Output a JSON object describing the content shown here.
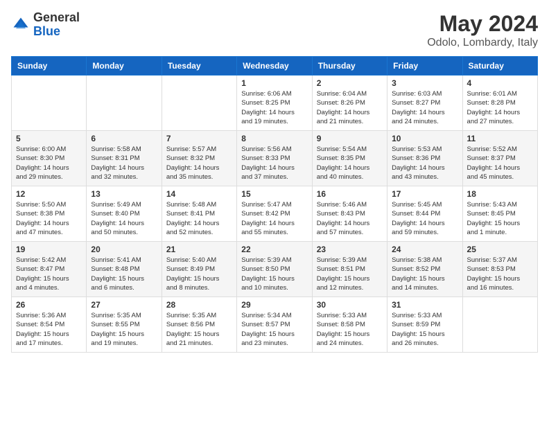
{
  "header": {
    "logo_general": "General",
    "logo_blue": "Blue",
    "month_title": "May 2024",
    "location": "Odolo, Lombardy, Italy"
  },
  "weekdays": [
    "Sunday",
    "Monday",
    "Tuesday",
    "Wednesday",
    "Thursday",
    "Friday",
    "Saturday"
  ],
  "weeks": [
    [
      {
        "day": "",
        "info": ""
      },
      {
        "day": "",
        "info": ""
      },
      {
        "day": "",
        "info": ""
      },
      {
        "day": "1",
        "info": "Sunrise: 6:06 AM\nSunset: 8:25 PM\nDaylight: 14 hours\nand 19 minutes."
      },
      {
        "day": "2",
        "info": "Sunrise: 6:04 AM\nSunset: 8:26 PM\nDaylight: 14 hours\nand 21 minutes."
      },
      {
        "day": "3",
        "info": "Sunrise: 6:03 AM\nSunset: 8:27 PM\nDaylight: 14 hours\nand 24 minutes."
      },
      {
        "day": "4",
        "info": "Sunrise: 6:01 AM\nSunset: 8:28 PM\nDaylight: 14 hours\nand 27 minutes."
      }
    ],
    [
      {
        "day": "5",
        "info": "Sunrise: 6:00 AM\nSunset: 8:30 PM\nDaylight: 14 hours\nand 29 minutes."
      },
      {
        "day": "6",
        "info": "Sunrise: 5:58 AM\nSunset: 8:31 PM\nDaylight: 14 hours\nand 32 minutes."
      },
      {
        "day": "7",
        "info": "Sunrise: 5:57 AM\nSunset: 8:32 PM\nDaylight: 14 hours\nand 35 minutes."
      },
      {
        "day": "8",
        "info": "Sunrise: 5:56 AM\nSunset: 8:33 PM\nDaylight: 14 hours\nand 37 minutes."
      },
      {
        "day": "9",
        "info": "Sunrise: 5:54 AM\nSunset: 8:35 PM\nDaylight: 14 hours\nand 40 minutes."
      },
      {
        "day": "10",
        "info": "Sunrise: 5:53 AM\nSunset: 8:36 PM\nDaylight: 14 hours\nand 43 minutes."
      },
      {
        "day": "11",
        "info": "Sunrise: 5:52 AM\nSunset: 8:37 PM\nDaylight: 14 hours\nand 45 minutes."
      }
    ],
    [
      {
        "day": "12",
        "info": "Sunrise: 5:50 AM\nSunset: 8:38 PM\nDaylight: 14 hours\nand 47 minutes."
      },
      {
        "day": "13",
        "info": "Sunrise: 5:49 AM\nSunset: 8:40 PM\nDaylight: 14 hours\nand 50 minutes."
      },
      {
        "day": "14",
        "info": "Sunrise: 5:48 AM\nSunset: 8:41 PM\nDaylight: 14 hours\nand 52 minutes."
      },
      {
        "day": "15",
        "info": "Sunrise: 5:47 AM\nSunset: 8:42 PM\nDaylight: 14 hours\nand 55 minutes."
      },
      {
        "day": "16",
        "info": "Sunrise: 5:46 AM\nSunset: 8:43 PM\nDaylight: 14 hours\nand 57 minutes."
      },
      {
        "day": "17",
        "info": "Sunrise: 5:45 AM\nSunset: 8:44 PM\nDaylight: 14 hours\nand 59 minutes."
      },
      {
        "day": "18",
        "info": "Sunrise: 5:43 AM\nSunset: 8:45 PM\nDaylight: 15 hours\nand 1 minute."
      }
    ],
    [
      {
        "day": "19",
        "info": "Sunrise: 5:42 AM\nSunset: 8:47 PM\nDaylight: 15 hours\nand 4 minutes."
      },
      {
        "day": "20",
        "info": "Sunrise: 5:41 AM\nSunset: 8:48 PM\nDaylight: 15 hours\nand 6 minutes."
      },
      {
        "day": "21",
        "info": "Sunrise: 5:40 AM\nSunset: 8:49 PM\nDaylight: 15 hours\nand 8 minutes."
      },
      {
        "day": "22",
        "info": "Sunrise: 5:39 AM\nSunset: 8:50 PM\nDaylight: 15 hours\nand 10 minutes."
      },
      {
        "day": "23",
        "info": "Sunrise: 5:39 AM\nSunset: 8:51 PM\nDaylight: 15 hours\nand 12 minutes."
      },
      {
        "day": "24",
        "info": "Sunrise: 5:38 AM\nSunset: 8:52 PM\nDaylight: 15 hours\nand 14 minutes."
      },
      {
        "day": "25",
        "info": "Sunrise: 5:37 AM\nSunset: 8:53 PM\nDaylight: 15 hours\nand 16 minutes."
      }
    ],
    [
      {
        "day": "26",
        "info": "Sunrise: 5:36 AM\nSunset: 8:54 PM\nDaylight: 15 hours\nand 17 minutes."
      },
      {
        "day": "27",
        "info": "Sunrise: 5:35 AM\nSunset: 8:55 PM\nDaylight: 15 hours\nand 19 minutes."
      },
      {
        "day": "28",
        "info": "Sunrise: 5:35 AM\nSunset: 8:56 PM\nDaylight: 15 hours\nand 21 minutes."
      },
      {
        "day": "29",
        "info": "Sunrise: 5:34 AM\nSunset: 8:57 PM\nDaylight: 15 hours\nand 23 minutes."
      },
      {
        "day": "30",
        "info": "Sunrise: 5:33 AM\nSunset: 8:58 PM\nDaylight: 15 hours\nand 24 minutes."
      },
      {
        "day": "31",
        "info": "Sunrise: 5:33 AM\nSunset: 8:59 PM\nDaylight: 15 hours\nand 26 minutes."
      },
      {
        "day": "",
        "info": ""
      }
    ]
  ]
}
